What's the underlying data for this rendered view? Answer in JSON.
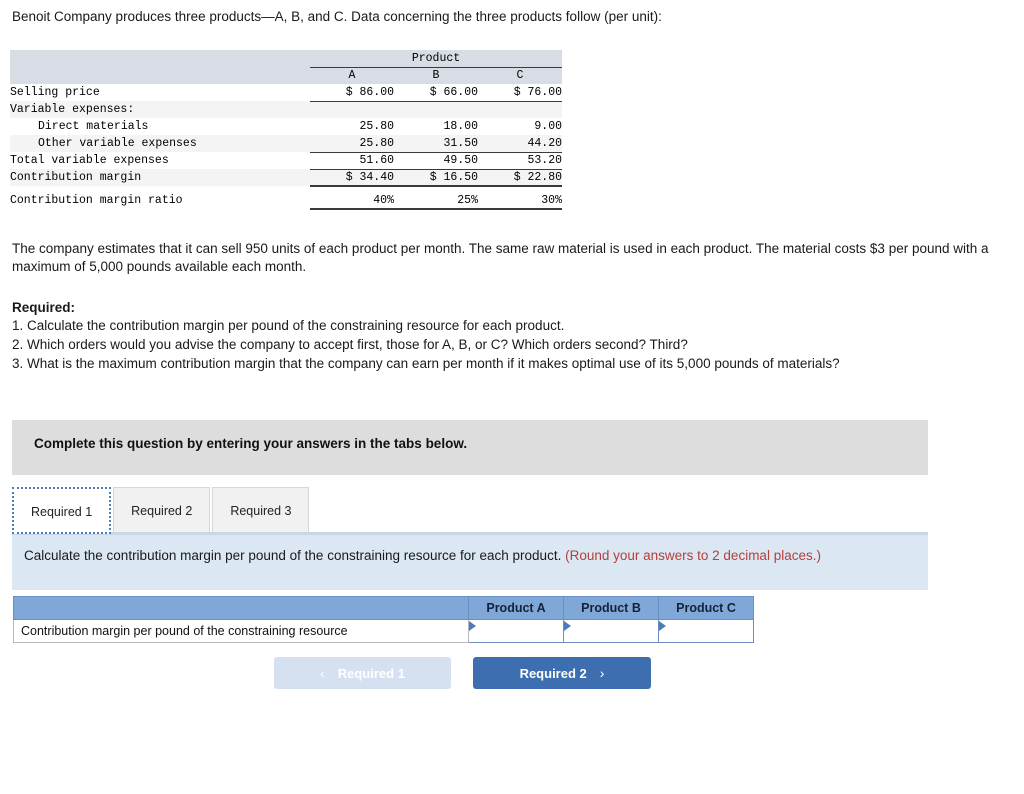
{
  "intro": "Benoit Company produces three products—A, B, and C. Data concerning the three products follow (per unit):",
  "data_table": {
    "group_header": "Product",
    "columns": [
      "A",
      "B",
      "C"
    ],
    "rows": [
      {
        "label": "Selling price",
        "indent": false,
        "values": [
          "$  86.00",
          "$  66.00",
          "$  76.00"
        ]
      },
      {
        "label": "Variable expenses:",
        "indent": false,
        "values": [
          "",
          "",
          ""
        ]
      },
      {
        "label": "Direct materials",
        "indent": true,
        "values": [
          "25.80",
          "18.00",
          "9.00"
        ]
      },
      {
        "label": "Other variable expenses",
        "indent": true,
        "values": [
          "25.80",
          "31.50",
          "44.20"
        ]
      },
      {
        "label": "Total variable expenses",
        "indent": false,
        "values": [
          "51.60",
          "49.50",
          "53.20"
        ]
      },
      {
        "label": "Contribution margin",
        "indent": false,
        "values": [
          "$  34.40",
          "$  16.50",
          "$  22.80"
        ]
      },
      {
        "label": "Contribution margin ratio",
        "indent": false,
        "values": [
          "40%",
          "25%",
          "30%"
        ]
      }
    ]
  },
  "paragraphs": {
    "p1": "The company estimates that it can sell 950 units of each product per month. The same raw material is used in each product. The material costs $3 per pound with a maximum of 5,000 pounds available each month.",
    "required_heading": "Required:",
    "r1": "1. Calculate the contribution margin per pound of the constraining resource for each product.",
    "r2": "2. Which orders would you advise the company to accept first, those for A, B, or C? Which orders second? Third?",
    "r3": "3. What is the maximum contribution margin that the company can earn per month if it makes optimal use of its 5,000 pounds of materials?"
  },
  "gray_banner": {
    "text": "Complete this question by entering your answers in the tabs below."
  },
  "tabs": [
    {
      "label": "Required 1",
      "active": true
    },
    {
      "label": "Required 2",
      "active": false
    },
    {
      "label": "Required 3",
      "active": false
    }
  ],
  "instruction": {
    "main": "Calculate the contribution margin per pound of the constraining resource for each product.",
    "note": "(Round your answers to 2 decimal places.)"
  },
  "answer_table": {
    "blank_header": "",
    "headers": [
      "Product A",
      "Product B",
      "Product C"
    ],
    "row_label": "Contribution margin per pound of the constraining resource",
    "values": [
      "",
      "",
      ""
    ]
  },
  "nav": {
    "prev_label": "Required 1",
    "prev_chevron": "‹",
    "next_label": "Required 2",
    "next_chevron": "›"
  },
  "colors": {
    "table_header_bg": "#d7dce5",
    "gray_banner_bg": "#dddddd",
    "blue_panel_bg": "#dce7f4",
    "answer_header_bg": "#7fa8d8",
    "accent_blue": "#3d6fb0",
    "note_red": "#b3403a"
  }
}
